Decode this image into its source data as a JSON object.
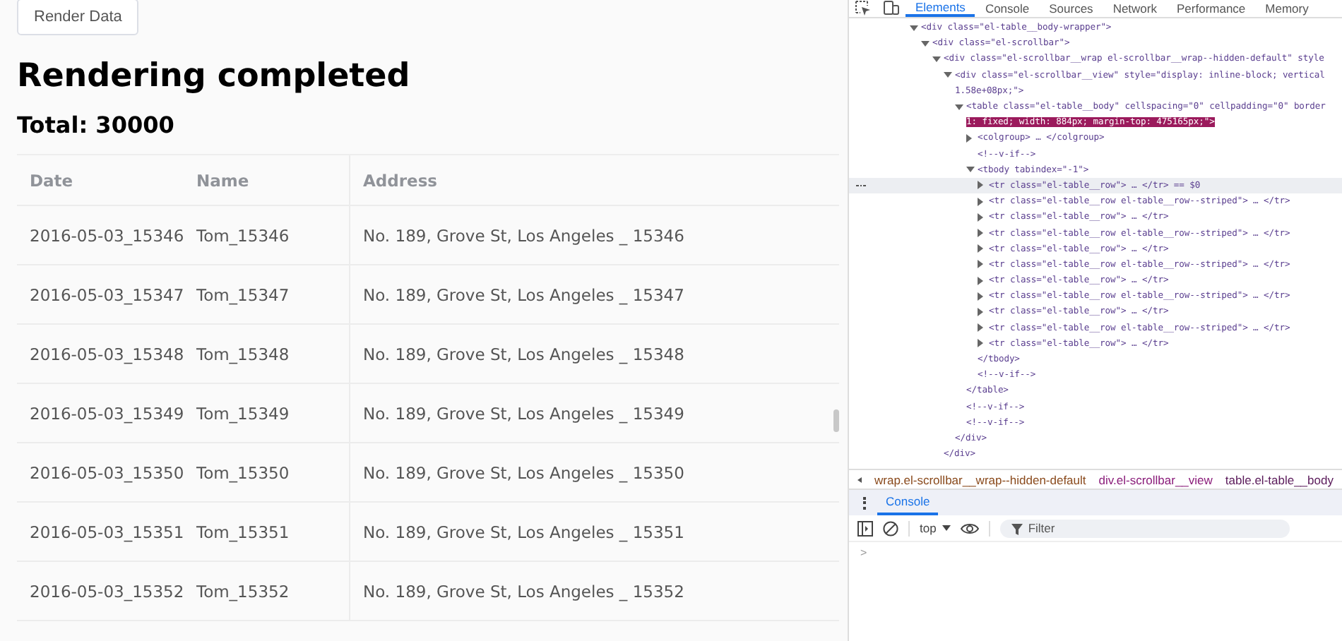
{
  "page": {
    "button": "Render Data",
    "heading": "Rendering completed",
    "total": "Total: 30000",
    "table": {
      "columns": [
        "Date",
        "Name",
        "Address"
      ],
      "rows": [
        [
          "2016-05-03_15346",
          "Tom_15346",
          "No. 189, Grove St, Los Angeles _ 15346"
        ],
        [
          "2016-05-03_15347",
          "Tom_15347",
          "No. 189, Grove St, Los Angeles _ 15347"
        ],
        [
          "2016-05-03_15348",
          "Tom_15348",
          "No. 189, Grove St, Los Angeles _ 15348"
        ],
        [
          "2016-05-03_15349",
          "Tom_15349",
          "No. 189, Grove St, Los Angeles _ 15349"
        ],
        [
          "2016-05-03_15350",
          "Tom_15350",
          "No. 189, Grove St, Los Angeles _ 15350"
        ],
        [
          "2016-05-03_15351",
          "Tom_15351",
          "No. 189, Grove St, Los Angeles _ 15351"
        ],
        [
          "2016-05-03_15352",
          "Tom_15352",
          "No. 189, Grove St, Los Angeles _ 15352"
        ]
      ]
    }
  },
  "devtools": {
    "tabs": [
      {
        "label": "Elements",
        "selected": true
      },
      {
        "label": "Console",
        "selected": false
      },
      {
        "label": "Sources",
        "selected": false
      },
      {
        "label": "Network",
        "selected": false
      },
      {
        "label": "Performance",
        "selected": false
      },
      {
        "label": "Memory",
        "selected": false
      }
    ],
    "tree": [
      {
        "text": "<div class=\"el-table__body-wrapper\">",
        "expanded": true,
        "selected": false,
        "children": [
          {
            "text": "<div class=\"el-scrollbar\">",
            "expanded": true,
            "selected": false,
            "children": [
              {
                "text": "<div class=\"el-scrollbar__wrap el-scrollbar__wrap--hidden-default\" style",
                "expanded": true,
                "selected": false,
                "closing": "</div>",
                "children": [
                  {
                    "text": "<div class=\"el-scrollbar__view\" style=\"display: inline-block; vertical",
                    "continuation": "1.58e+08px;\">",
                    "continuation_selected": false,
                    "expanded": true,
                    "selected": false,
                    "closing": "</div>",
                    "children": [
                      {
                        "text": "<table class=\"el-table__body\" cellspacing=\"0\" cellpadding=\"0\" border",
                        "continuation": "1: fixed; width: 884px; margin-top: 475165px;\">",
                        "continuation_selected": true,
                        "expanded": true,
                        "selected": false,
                        "closing": "</table>",
                        "children": [
                          {
                            "text": "<colgroup> … </colgroup>",
                            "expanded": false,
                            "selected": false
                          },
                          {
                            "text": "<!--v-if-->",
                            "selected": false
                          },
                          {
                            "text": "<tbody tabindex=\"-1\">",
                            "expanded": true,
                            "selected": false,
                            "closing": "</tbody>",
                            "children": [
                              {
                                "text": "<tr class=\"el-table__row\"> … </tr> == $0",
                                "expanded": false,
                                "selected": true
                              },
                              {
                                "text": "<tr class=\"el-table__row el-table__row--striped\"> … </tr>",
                                "expanded": false,
                                "selected": false
                              },
                              {
                                "text": "<tr class=\"el-table__row\"> … </tr>",
                                "expanded": false,
                                "selected": false
                              },
                              {
                                "text": "<tr class=\"el-table__row el-table__row--striped\"> … </tr>",
                                "expanded": false,
                                "selected": false
                              },
                              {
                                "text": "<tr class=\"el-table__row\"> … </tr>",
                                "expanded": false,
                                "selected": false
                              },
                              {
                                "text": "<tr class=\"el-table__row el-table__row--striped\"> … </tr>",
                                "expanded": false,
                                "selected": false
                              },
                              {
                                "text": "<tr class=\"el-table__row\"> … </tr>",
                                "expanded": false,
                                "selected": false
                              },
                              {
                                "text": "<tr class=\"el-table__row el-table__row--striped\"> … </tr>",
                                "expanded": false,
                                "selected": false
                              },
                              {
                                "text": "<tr class=\"el-table__row\"> … </tr>",
                                "expanded": false,
                                "selected": false
                              },
                              {
                                "text": "<tr class=\"el-table__row el-table__row--striped\"> … </tr>",
                                "expanded": false,
                                "selected": false
                              },
                              {
                                "text": "<tr class=\"el-table__row\"> … </tr>",
                                "expanded": false,
                                "selected": false
                              }
                            ]
                          },
                          {
                            "text": "<!--v-if-->",
                            "selected": false
                          }
                        ]
                      },
                      {
                        "text": "<!--v-if-->",
                        "selected": false
                      },
                      {
                        "text": "<!--v-if-->",
                        "selected": false
                      }
                    ]
                  }
                ]
              }
            ]
          }
        ]
      }
    ],
    "breadcrumb": [
      {
        "label": "wrap.el-scrollbar__wrap--hidden-default",
        "selected": false
      },
      {
        "label": "div.el-scrollbar__view",
        "selected": false
      },
      {
        "label": "table.el-table__body",
        "selected": true
      }
    ],
    "drawer": {
      "tabs": [
        {
          "label": "Console",
          "selected": true
        }
      ],
      "context": "top",
      "filter": {
        "placeholder": "Filter"
      },
      "prompt": ">"
    }
  }
}
